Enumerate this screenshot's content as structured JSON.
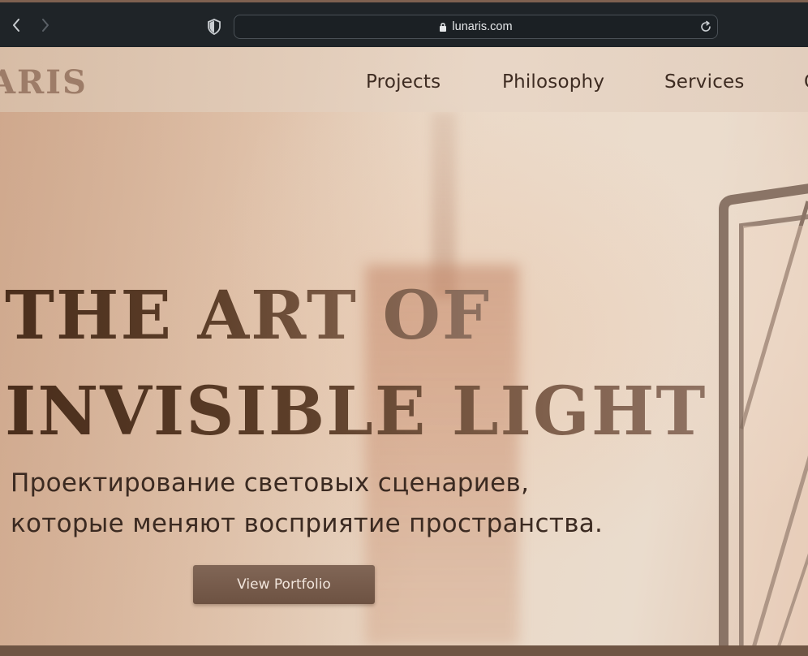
{
  "browser": {
    "url": "lunaris.com",
    "icons": [
      "back-icon",
      "forward-icon",
      "privacy-shield-icon",
      "lock-icon",
      "reload-icon"
    ]
  },
  "site": {
    "brand": "ARIS",
    "nav": [
      {
        "label": "Projects"
      },
      {
        "label": "Philosophy"
      },
      {
        "label": "Services"
      },
      {
        "label": "C"
      }
    ]
  },
  "hero": {
    "line1": "THE ART OF",
    "line2": "INVISIBLE LIGHT",
    "subtitle_line1": "Проектирование световых сценариев,",
    "subtitle_line2": "которые меняют восприятие пространства.",
    "cta_label": "View Portfolio"
  },
  "colors": {
    "chrome": "#1f2428",
    "headline": "#4a2e1c",
    "button": "#765b4a",
    "background": "#e4c8b1"
  }
}
